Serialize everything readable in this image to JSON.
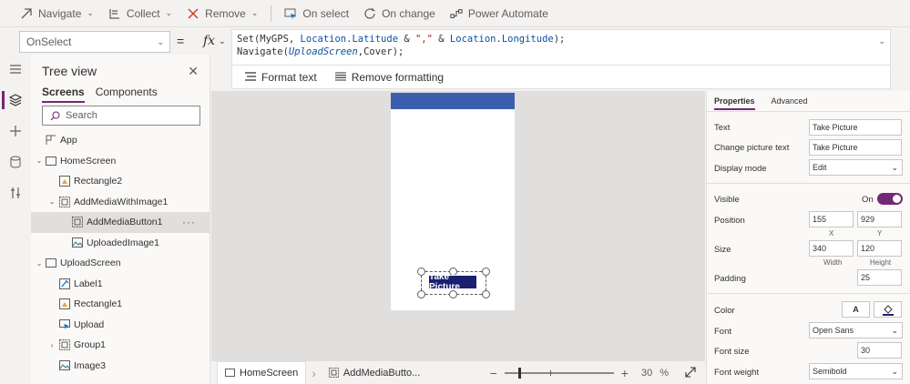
{
  "toolbar": {
    "navigate": "Navigate",
    "collect": "Collect",
    "remove": "Remove",
    "on_select": "On select",
    "on_change": "On change",
    "power_automate": "Power Automate"
  },
  "formula": {
    "property": "OnSelect",
    "equals": "=",
    "fx": "fx",
    "line1": {
      "set_open": "Set(MyGPS, ",
      "lat": "Location.Latitude",
      "amp1": " & ",
      "comma": "\",\"",
      "amp2": " & ",
      "lon": "Location.Longitude",
      "close": ");"
    },
    "line2": {
      "nav_open": "Navigate(",
      "screen": "UploadScreen",
      "rest": ",Cover);"
    },
    "format_text": "Format text",
    "remove_formatting": "Remove formatting"
  },
  "tree": {
    "title": "Tree view",
    "tabs": [
      "Screens",
      "Components"
    ],
    "search_placeholder": "Search",
    "items": [
      {
        "label": "App",
        "icon": "app-icon"
      },
      {
        "label": "HomeScreen",
        "icon": "screen-icon"
      },
      {
        "label": "Rectangle2",
        "icon": "shape-icon"
      },
      {
        "label": "AddMediaWithImage1",
        "icon": "group-icon"
      },
      {
        "label": "AddMediaButton1",
        "icon": "button-icon"
      },
      {
        "label": "UploadedImage1",
        "icon": "image-icon"
      },
      {
        "label": "UploadScreen",
        "icon": "screen-icon"
      },
      {
        "label": "Label1",
        "icon": "label-icon"
      },
      {
        "label": "Rectangle1",
        "icon": "shape-icon"
      },
      {
        "label": "Upload",
        "icon": "button-icon"
      },
      {
        "label": "Group1",
        "icon": "group-icon"
      },
      {
        "label": "Image3",
        "icon": "image-icon"
      }
    ]
  },
  "canvas": {
    "button_text": "Take Picture",
    "header_color": "#3b5fad"
  },
  "status": {
    "screen": "HomeScreen",
    "control": "AddMediaButto...",
    "zoom_value": "30",
    "zoom_unit": "%"
  },
  "properties": {
    "tabs": [
      "Properties",
      "Advanced"
    ],
    "text_label": "Text",
    "text_value": "Take Picture",
    "change_label": "Change picture text",
    "change_value": "Take Picture",
    "display_label": "Display mode",
    "display_value": "Edit",
    "visible_label": "Visible",
    "visible_value": "On",
    "position_label": "Position",
    "position_x": "155",
    "position_y": "929",
    "x_label": "X",
    "y_label": "Y",
    "size_label": "Size",
    "size_w": "340",
    "size_h": "120",
    "w_label": "Width",
    "h_label": "Height",
    "padding_label": "Padding",
    "padding_value": "25",
    "color_label": "Color",
    "color_text_btn": "A",
    "font_label": "Font",
    "font_value": "Open Sans",
    "fontsize_label": "Font size",
    "fontsize_value": "30",
    "fontweight_label": "Font weight",
    "fontweight_value": "Semibold"
  },
  "colors": {
    "accent": "#742774",
    "button_fill": "#1a2070"
  }
}
